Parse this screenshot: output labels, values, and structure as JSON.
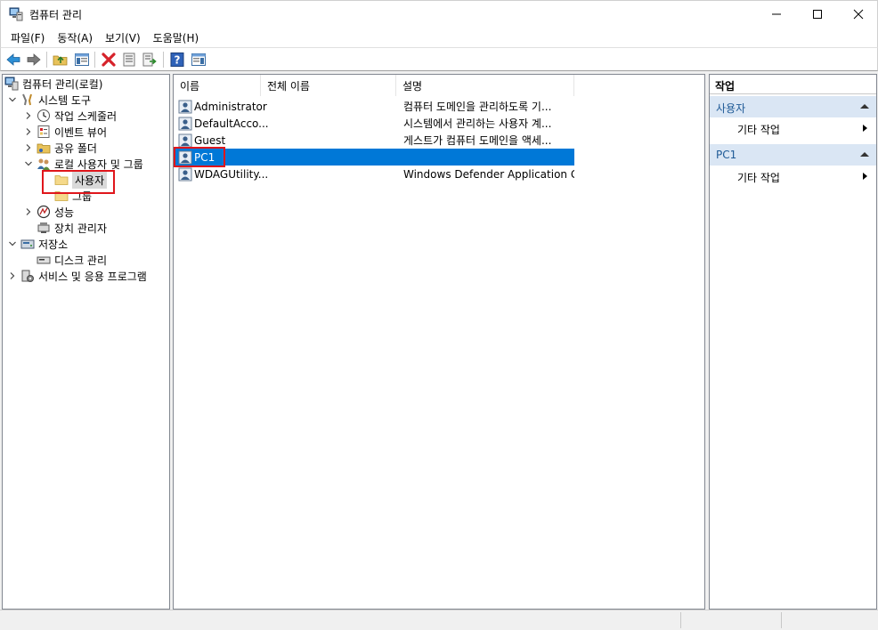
{
  "window": {
    "title": "컴퓨터 관리"
  },
  "menu": [
    "파일(F)",
    "동작(A)",
    "보기(V)",
    "도움말(H)"
  ],
  "toolbar": {
    "buttons": [
      "back-icon",
      "forward-icon",
      "up-folder-icon",
      "show-hide-tree-icon",
      "delete-icon",
      "properties-icon",
      "export-list-icon",
      "help-icon",
      "show-hide-action-pane-icon"
    ]
  },
  "tree": {
    "root": "컴퓨터 관리(로컬)",
    "system_tools": "시스템 도구",
    "task_scheduler": "작업 스케줄러",
    "event_viewer": "이벤트 뷰어",
    "shared_folders": "공유 폴더",
    "local_users_groups": "로컬 사용자 및 그룹",
    "users": "사용자",
    "groups": "그룹",
    "performance": "성능",
    "device_manager": "장치 관리자",
    "storage": "저장소",
    "disk_management": "디스크 관리",
    "services_apps": "서비스 및 응용 프로그램"
  },
  "list": {
    "columns": [
      "이름",
      "전체 이름",
      "설명"
    ],
    "rows": [
      {
        "name": "Administrator",
        "full_name": "",
        "description": "컴퓨터 도메인을 관리하도록 기..."
      },
      {
        "name": "DefaultAcco...",
        "full_name": "",
        "description": "시스템에서 관리하는 사용자 계..."
      },
      {
        "name": "Guest",
        "full_name": "",
        "description": "게스트가 컴퓨터 도메인을 액세..."
      },
      {
        "name": "PC1",
        "full_name": "",
        "description": ""
      },
      {
        "name": "WDAGUtility...",
        "full_name": "",
        "description": "Windows Defender Application G..."
      }
    ],
    "selected_index": 3
  },
  "actions": {
    "header": "작업",
    "sections": [
      {
        "title": "사용자",
        "items": [
          "기타 작업"
        ]
      },
      {
        "title": "PC1",
        "items": [
          "기타 작업"
        ]
      }
    ]
  },
  "colors": {
    "selection": "#0078d7",
    "highlight_box": "#e0161b",
    "action_section_bg": "#dae6f4",
    "action_section_text": "#1e5a96"
  }
}
